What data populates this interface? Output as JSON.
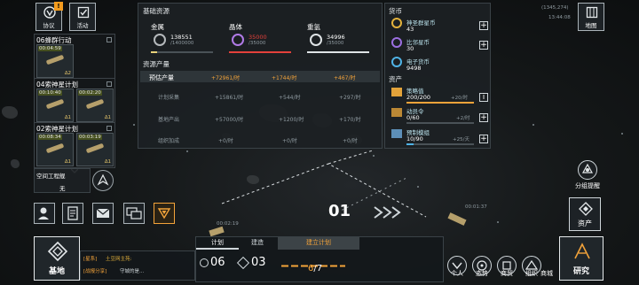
{
  "nav": {
    "agreement_label": "协议",
    "agreement_badge": "!",
    "activity_label": "活动"
  },
  "missions": [
    {
      "title": "06蜂群行动",
      "slots": [
        {
          "time": "00:04:59",
          "sub": "∆2"
        }
      ]
    },
    {
      "title": "04索神星计划",
      "slots": [
        {
          "time": "00:10:40",
          "sub": "∆1"
        },
        {
          "time": "00:02:20",
          "sub": "∆1"
        }
      ]
    },
    {
      "title": "02索神星计划",
      "slots": [
        {
          "time": "00:08:34",
          "sub": "∆1"
        },
        {
          "time": "00:03:19",
          "sub": "∆1"
        }
      ]
    }
  ],
  "engineer": {
    "label": "空间工程舰",
    "value": "无"
  },
  "resources": {
    "base_title": "基础资源",
    "metal": {
      "name": "金属",
      "amount": "138551",
      "cap": "/1400000",
      "pct": 0.1
    },
    "crystal": {
      "name": "晶体",
      "amount": "35000",
      "cap": "/35000",
      "pct": 1.0
    },
    "deuterium": {
      "name": "重氢",
      "amount": "34996",
      "cap": "/35000",
      "pct": 1.0
    },
    "prod_title": "资源产量",
    "rows": [
      {
        "label": "预估产量",
        "metal": "+72961/时",
        "crystal": "+1744/时",
        "deut": "+467/时"
      },
      {
        "label": "计划采集",
        "metal": "+15861/时",
        "crystal": "+544/时",
        "deut": "+297/时"
      },
      {
        "label": "基地产出",
        "metal": "+57000/时",
        "crystal": "+1200/时",
        "deut": "+170/时"
      },
      {
        "label": "组织加成",
        "metal": "+0/时",
        "crystal": "+0/时",
        "deut": "+0/时"
      }
    ]
  },
  "currency": {
    "title": "货币",
    "items": [
      {
        "name": "神圣群星币",
        "value": "43"
      },
      {
        "name": "比邻星币",
        "value": "30"
      },
      {
        "name": "电子货币",
        "value": "9498"
      }
    ]
  },
  "assets": {
    "title": "资产",
    "items": [
      {
        "name": "策略值",
        "value": "200/200",
        "rate": "+20/时",
        "pct": 1.0
      },
      {
        "name": "动员令",
        "value": "0/60",
        "rate": "+2/时",
        "pct": 0
      },
      {
        "name": "预制模组",
        "value": "10/90",
        "rate": "+25/天",
        "pct": 0.11
      }
    ]
  },
  "map": {
    "coords": "(1345,274)",
    "time": "13:44:08",
    "map_label": "地图"
  },
  "right": {
    "fleet_reminder": "分组提醒",
    "assets_label": "资产",
    "research_label": "研究"
  },
  "scene": {
    "marker": "01",
    "timer_left": "00:02:19",
    "timer_right": "00:01:37"
  },
  "bottom": {
    "base_label": "基地",
    "chat_line1_tag": "[星系]",
    "chat_line1": "土豆网主苑:",
    "chat_line2_tag": "[战报分享]",
    "chat_line2": "守城的是...",
    "tab_plan": "计划",
    "tab_build": "建造",
    "tab_build_plan": "建立计划",
    "plan_count": "06",
    "build_count": "03",
    "progress_current": "6",
    "progress_total": "/7",
    "menu": [
      "个人",
      "态势",
      "商贸",
      "组织",
      "商城"
    ]
  },
  "colors": {
    "accent": "#f3a33a",
    "warning": "#e3413b",
    "crystal": "#b07ae6",
    "metal": "#e9d27a"
  }
}
